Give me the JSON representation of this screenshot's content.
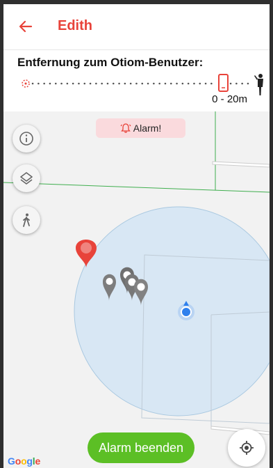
{
  "header": {
    "title": "Edith"
  },
  "distance": {
    "title": "Entfernung zum Otiom-Benutzer:",
    "range": "0 - 20m"
  },
  "map": {
    "alarm_badge": "Alarm!",
    "end_alarm_label": "Alarm beenden",
    "attribution": "Google"
  },
  "colors": {
    "accent": "#e8433a",
    "end_alarm": "#5cbf25",
    "alarm_badge_bg": "#fadadd",
    "user_dot": "#2f80ed"
  }
}
